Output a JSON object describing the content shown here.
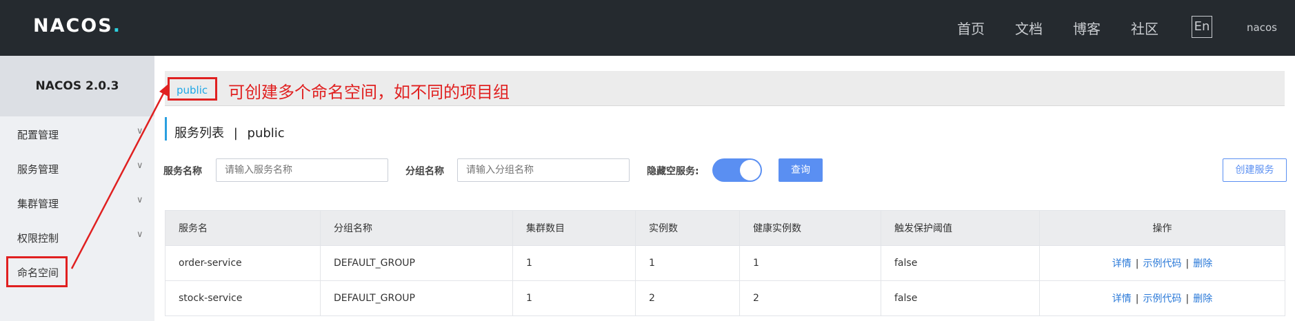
{
  "header": {
    "logo": "NACOS",
    "logo_dot": ".",
    "nav": [
      "首页",
      "文档",
      "博客",
      "社区"
    ],
    "lang": "En",
    "user": "nacos"
  },
  "sidebar": {
    "title": "NACOS 2.0.3",
    "items": [
      {
        "label": "配置管理",
        "expandable": true
      },
      {
        "label": "服务管理",
        "expandable": true
      },
      {
        "label": "集群管理",
        "expandable": true
      },
      {
        "label": "权限控制",
        "expandable": true
      },
      {
        "label": "命名空间",
        "expandable": false
      }
    ]
  },
  "namespace": {
    "current": "public",
    "annotation": "可创建多个命名空间，如不同的项目组"
  },
  "page": {
    "title": "服务列表",
    "title_sep": "|",
    "title_ns": "public"
  },
  "filters": {
    "service_name_label": "服务名称",
    "service_name_placeholder": "请输入服务名称",
    "group_name_label": "分组名称",
    "group_name_placeholder": "请输入分组名称",
    "hide_empty_label": "隐藏空服务:",
    "hide_empty_on": true,
    "query_button": "查询",
    "create_button": "创建服务"
  },
  "table": {
    "columns": [
      "服务名",
      "分组名称",
      "集群数目",
      "实例数",
      "健康实例数",
      "触发保护阈值",
      "操作"
    ],
    "rows": [
      [
        "order-service",
        "DEFAULT_GROUP",
        "1",
        "1",
        "1",
        "false"
      ],
      [
        "stock-service",
        "DEFAULT_GROUP",
        "1",
        "2",
        "2",
        "false"
      ]
    ],
    "actions": [
      "详情",
      "示例代码",
      "删除"
    ],
    "action_sep": "|"
  },
  "colors": {
    "topbar": "#252a2f",
    "accent": "#5a8ff2",
    "annotation": "#e02020",
    "link": "#2a79d8"
  }
}
